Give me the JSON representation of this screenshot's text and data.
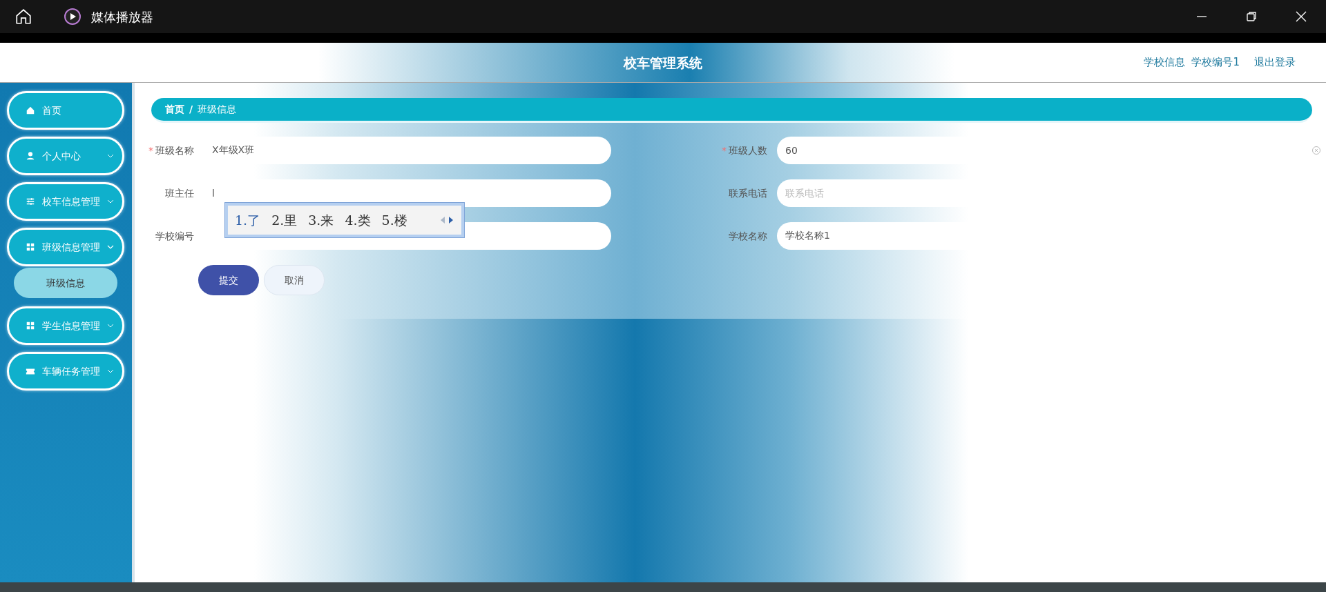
{
  "window": {
    "title": "媒体播放器"
  },
  "header": {
    "title": "校车管理系统",
    "links": [
      "学校信息  学校编号1",
      "退出登录"
    ]
  },
  "sidebar": {
    "items": [
      {
        "label": "首页",
        "expandable": false
      },
      {
        "label": "个人中心",
        "expandable": true,
        "expanded": false
      },
      {
        "label": "校车信息管理",
        "expandable": true,
        "expanded": false
      },
      {
        "label": "班级信息管理",
        "expandable": true,
        "expanded": true,
        "children": [
          {
            "label": "班级信息",
            "selected": true
          }
        ]
      },
      {
        "label": "学生信息管理",
        "expandable": true,
        "expanded": false
      },
      {
        "label": "车辆任务管理",
        "expandable": true,
        "expanded": false
      }
    ]
  },
  "breadcrumb": [
    "首页",
    "/",
    "班级信息"
  ],
  "form": {
    "fields": [
      {
        "label": "班级名称",
        "required_mark": "*",
        "value": "X年级X班"
      },
      {
        "label": "班级人数",
        "required_mark": "*",
        "value": "60",
        "clearable": true
      },
      {
        "label": "班主任",
        "value": "l"
      },
      {
        "label": "联系电话",
        "placeholder": "联系电话"
      },
      {
        "label": "学校编号"
      },
      {
        "label": "学校名称",
        "value": "学校名称1"
      }
    ],
    "buttons": [
      {
        "label": "提交",
        "kind": "primary"
      },
      {
        "label": "取消",
        "kind": "secondary"
      }
    ]
  },
  "ime_popup": {
    "candidates": [
      {
        "text": "1.了",
        "selected": true
      },
      {
        "text": "2.里",
        "selected": false
      },
      {
        "text": "3.来",
        "selected": false
      },
      {
        "text": "4.类",
        "selected": false
      },
      {
        "text": "5.楼",
        "selected": false
      }
    ]
  }
}
